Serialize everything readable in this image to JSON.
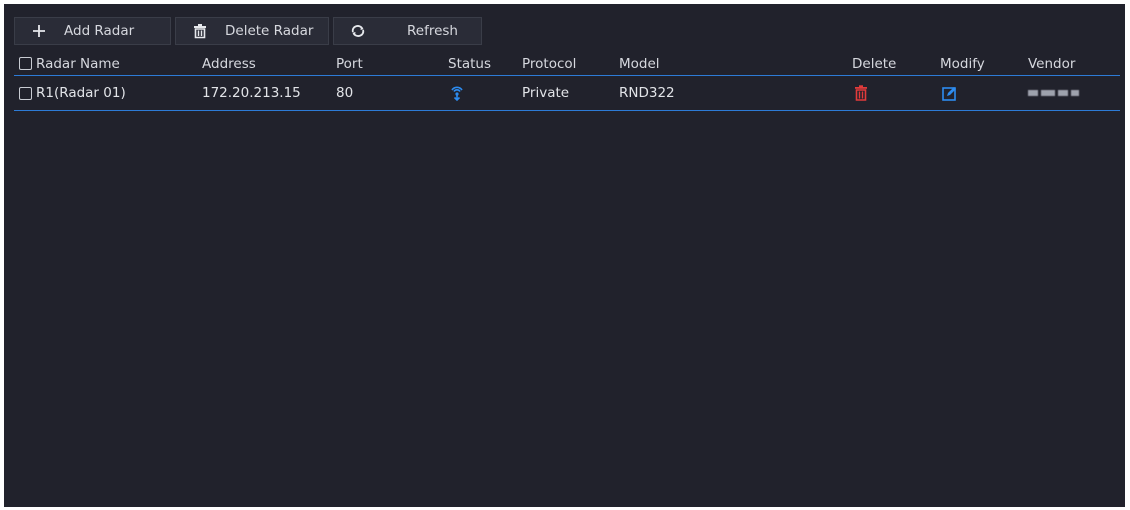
{
  "toolbar": {
    "add_label": "Add Radar",
    "delete_label": "Delete Radar",
    "refresh_label": "Refresh"
  },
  "table": {
    "headers": {
      "name": "Radar Name",
      "address": "Address",
      "port": "Port",
      "status": "Status",
      "protocol": "Protocol",
      "model": "Model",
      "delete": "Delete",
      "modify": "Modify",
      "vendor": "Vendor"
    },
    "rows": [
      {
        "name": "R1(Radar 01)",
        "address": "172.20.213.15",
        "port": "80",
        "status_icon": "online-status-icon",
        "protocol": "Private",
        "model": "RND322",
        "delete_icon": "trash-icon",
        "modify_icon": "edit-icon",
        "vendor": ""
      }
    ]
  },
  "colors": {
    "background": "#21222c",
    "accent": "#2d7bd6",
    "delete_red": "#e23b3b",
    "status_blue": "#2d8cf0"
  }
}
